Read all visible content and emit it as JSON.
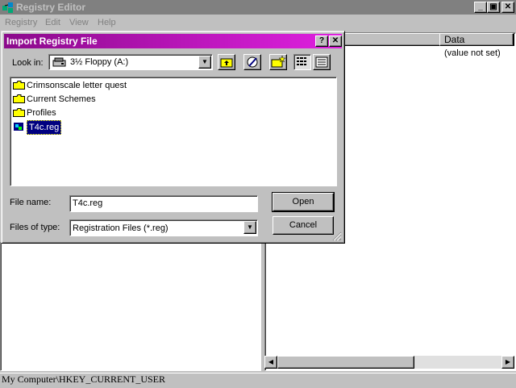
{
  "main_window": {
    "title": "Registry Editor",
    "controls": [
      "_",
      "▣",
      "✕"
    ],
    "menu": [
      "Registry",
      "Edit",
      "View",
      "Help"
    ],
    "column_header": "Data",
    "value_cell": "(value not set)",
    "status": "My Computer\\HKEY_CURRENT_USER"
  },
  "dialog": {
    "title": "Import Registry File",
    "help_btn": "?",
    "close_btn": "✕",
    "look_in_label": "Look in:",
    "look_in_value": "3½ Floppy (A:)",
    "items": [
      {
        "name": "Crimsonscale letter quest",
        "type": "folder"
      },
      {
        "name": "Current Schemes",
        "type": "folder"
      },
      {
        "name": "Profiles",
        "type": "folder"
      },
      {
        "name": "T4c.reg",
        "type": "reg",
        "selected": true
      }
    ],
    "file_name_label": "File name:",
    "file_name_value": "T4c.reg",
    "files_of_type_label": "Files of type:",
    "files_of_type_value": "Registration Files (*.reg)",
    "open_label": "Open",
    "cancel_label": "Cancel"
  },
  "colors": {
    "title_active_start": "#8b0a8b",
    "title_active_end": "#e020e0",
    "title_inactive": "#808080",
    "face": "#c0c0c0",
    "selection": "#000080"
  }
}
